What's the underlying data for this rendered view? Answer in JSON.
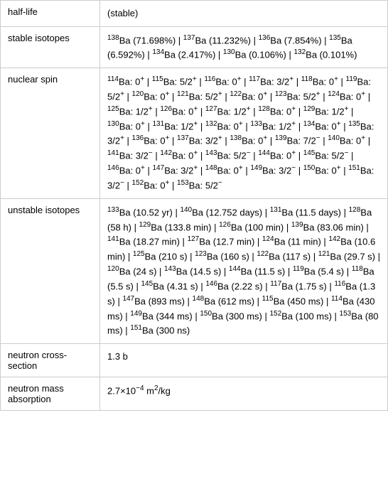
{
  "rows": [
    {
      "label": "half-life",
      "content_id": "half-life"
    },
    {
      "label": "stable isotopes",
      "content_id": "stable-isotopes"
    },
    {
      "label": "nuclear spin",
      "content_id": "nuclear-spin"
    },
    {
      "label": "unstable isotopes",
      "content_id": "unstable-isotopes"
    },
    {
      "label": "neutron cross-section",
      "content_id": "neutron-cross-section"
    },
    {
      "label": "neutron mass absorption",
      "content_id": "neutron-mass-absorption"
    }
  ],
  "labels": {
    "half-life": "half-life",
    "stable-isotopes": "stable isotopes",
    "nuclear-spin": "nuclear spin",
    "unstable-isotopes": "unstable isotopes",
    "neutron-cross-section": "neutron cross-section",
    "neutron-mass-absorption": "neutron mass absorption"
  }
}
